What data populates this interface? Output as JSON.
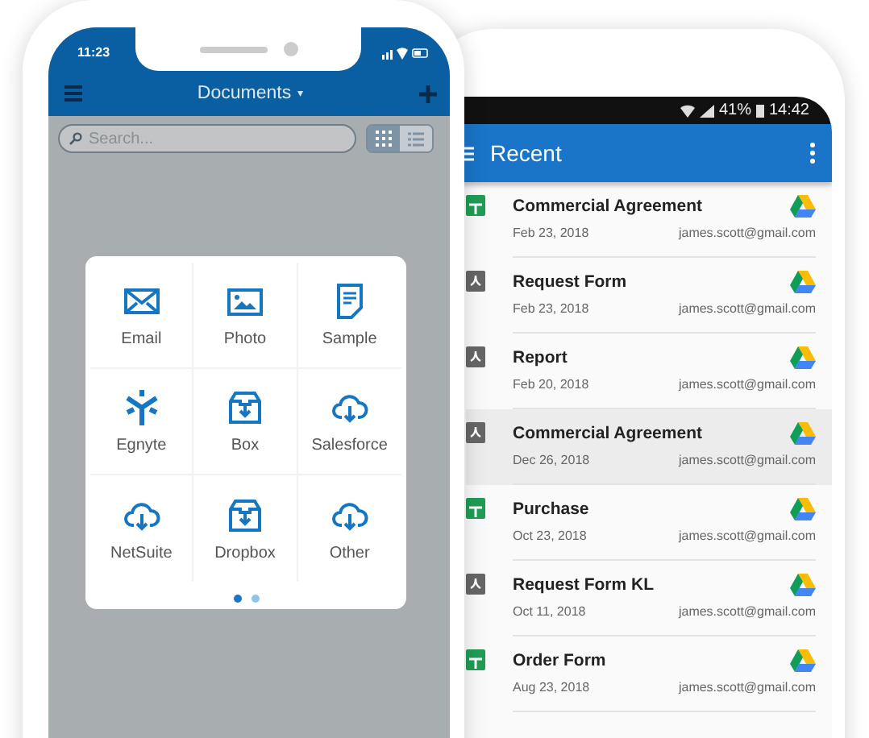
{
  "front_phone": {
    "status_time": "11:23",
    "header": {
      "title": "Documents",
      "dropdown": "▾"
    },
    "search": {
      "placeholder": "Search..."
    },
    "view_modes": [
      {
        "kind": "grid",
        "selected": true
      },
      {
        "kind": "list",
        "selected": false
      }
    ],
    "sources": [
      {
        "label": "Email",
        "kind": "email"
      },
      {
        "label": "Photo",
        "kind": "photo"
      },
      {
        "label": "Sample",
        "kind": "document"
      },
      {
        "label": "Egnyte",
        "kind": "egnyte"
      },
      {
        "label": "Box",
        "kind": "box"
      },
      {
        "label": "Salesforce",
        "kind": "cloud"
      },
      {
        "label": "NetSuite",
        "kind": "cloud"
      },
      {
        "label": "Dropbox",
        "kind": "box"
      },
      {
        "label": "Other",
        "kind": "cloud"
      }
    ],
    "pages": [
      {
        "selected": true
      },
      {
        "selected": false
      }
    ]
  },
  "back_phone": {
    "status": {
      "battery": "41%",
      "time": "14:42"
    },
    "app_bar": {
      "title": "Recent"
    },
    "files": [
      {
        "name": "Commercial Agreement",
        "date": "Feb 23, 2018",
        "account": "james.scott@gmail.com",
        "kind": "sheet",
        "selected": false
      },
      {
        "name": "Request Form",
        "date": "Feb 23, 2018",
        "account": "james.scott@gmail.com",
        "kind": "pdf",
        "selected": false
      },
      {
        "name": "Report",
        "date": "Feb 20, 2018",
        "account": "james.scott@gmail.com",
        "kind": "pdf",
        "selected": false
      },
      {
        "name": "Commercial Agreement",
        "date": "Dec 26, 2018",
        "account": "james.scott@gmail.com",
        "kind": "pdf",
        "selected": true
      },
      {
        "name": "Purchase",
        "date": "Oct 23, 2018",
        "account": "james.scott@gmail.com",
        "kind": "sheet",
        "selected": false
      },
      {
        "name": "Request Form KL",
        "date": "Oct 11, 2018",
        "account": "james.scott@gmail.com",
        "kind": "pdf",
        "selected": false
      },
      {
        "name": "Order Form",
        "date": "Aug 23, 2018",
        "account": "james.scott@gmail.com",
        "kind": "sheet",
        "selected": false
      }
    ]
  }
}
